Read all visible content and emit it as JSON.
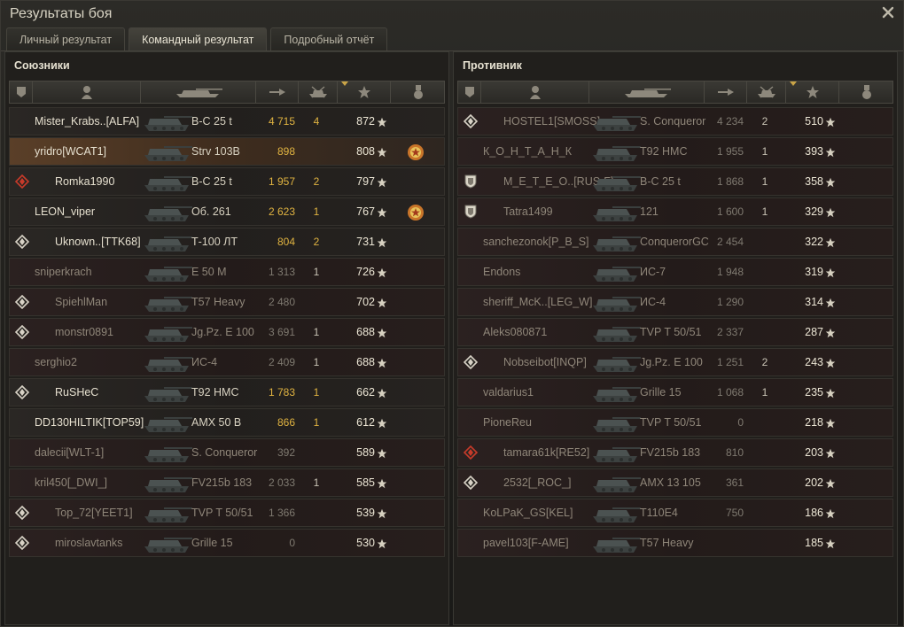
{
  "window": {
    "title": "Результаты боя"
  },
  "tabs": [
    {
      "label": "Личный результат",
      "active": false
    },
    {
      "label": "Командный результат",
      "active": true
    },
    {
      "label": "Подробный отчёт",
      "active": false
    }
  ],
  "columns": [
    {
      "icon": "rank-icon"
    },
    {
      "icon": "player-icon"
    },
    {
      "icon": "tank-icon"
    },
    {
      "icon": "damage-icon"
    },
    {
      "icon": "kills-icon"
    },
    {
      "icon": "experience-star-icon",
      "sorted": true
    },
    {
      "icon": "medal-icon"
    }
  ],
  "colors": {
    "damage": "#e0b341",
    "dim": "#7f7a70",
    "highlight": "#5a3f28"
  },
  "allies": {
    "title": "Союзники",
    "rows": [
      {
        "name": "Mister_Krabs..[ALFA]",
        "tank": "В-С 25 t",
        "damage": "4 715",
        "kills": "4",
        "xp": "872",
        "badge": "none",
        "medal": false,
        "dead": false,
        "highlight": false,
        "dmg_dim": false,
        "kills_dim": false
      },
      {
        "name": "yridro[WCAT1]",
        "tank": "Strv 103B",
        "damage": "898",
        "kills": "",
        "xp": "808",
        "badge": "none",
        "medal": true,
        "dead": false,
        "highlight": true,
        "dmg_dim": false
      },
      {
        "name": "Romka1990",
        "tank": "В-С 25 t",
        "damage": "1 957",
        "kills": "2",
        "xp": "797",
        "badge": "red",
        "medal": false,
        "dead": false,
        "highlight": false,
        "dmg_dim": false
      },
      {
        "name": "LEON_viper",
        "tank": "Об. 261",
        "damage": "2 623",
        "kills": "1",
        "xp": "767",
        "badge": "none",
        "medal": true,
        "dead": false,
        "highlight": false,
        "dmg_dim": false
      },
      {
        "name": "Uknown..[TTK68]",
        "tank": "Т-100 ЛТ",
        "damage": "804",
        "kills": "2",
        "xp": "731",
        "badge": "white",
        "medal": false,
        "dead": false,
        "highlight": false,
        "dmg_dim": false
      },
      {
        "name": "sniperkrach",
        "tank": "E 50 M",
        "damage": "1 313",
        "kills": "1",
        "xp": "726",
        "badge": "none",
        "medal": false,
        "dead": true,
        "highlight": false,
        "dmg_dim": true
      },
      {
        "name": "SpiehlMan",
        "tank": "T57 Heavy",
        "damage": "2 480",
        "kills": "",
        "xp": "702",
        "badge": "white",
        "medal": false,
        "dead": true,
        "highlight": false,
        "dmg_dim": true
      },
      {
        "name": "monstr0891",
        "tank": "Jg.Pz. E 100",
        "damage": "3 691",
        "kills": "1",
        "xp": "688",
        "badge": "white",
        "medal": false,
        "dead": true,
        "highlight": false,
        "dmg_dim": true
      },
      {
        "name": "serghio2",
        "tank": "ИС-4",
        "damage": "2 409",
        "kills": "1",
        "xp": "688",
        "badge": "none",
        "medal": false,
        "dead": true,
        "highlight": false,
        "dmg_dim": true
      },
      {
        "name": "RuSHeC",
        "tank": "T92 HMC",
        "damage": "1 783",
        "kills": "1",
        "xp": "662",
        "badge": "white",
        "medal": false,
        "dead": false,
        "highlight": false,
        "dmg_dim": false
      },
      {
        "name": "DD130HILTIK[TOP59]",
        "tank": "AMX 50 B",
        "damage": "866",
        "kills": "1",
        "xp": "612",
        "badge": "none",
        "medal": false,
        "dead": false,
        "highlight": false,
        "dmg_dim": false
      },
      {
        "name": "dalecii[WLT-1]",
        "tank": "S. Conqueror",
        "damage": "392",
        "kills": "",
        "xp": "589",
        "badge": "none",
        "medal": false,
        "dead": true,
        "highlight": false,
        "dmg_dim": true
      },
      {
        "name": "kril450[_DWI_]",
        "tank": "FV215b 183",
        "damage": "2 033",
        "kills": "1",
        "xp": "585",
        "badge": "none",
        "medal": false,
        "dead": true,
        "highlight": false,
        "dmg_dim": true
      },
      {
        "name": "Top_72[YEET1]",
        "tank": "TVP T 50/51",
        "damage": "1 366",
        "kills": "",
        "xp": "539",
        "badge": "white",
        "medal": false,
        "dead": true,
        "highlight": false,
        "dmg_dim": true
      },
      {
        "name": "miroslavtanks",
        "tank": "Grille 15",
        "damage": "0",
        "kills": "",
        "xp": "530",
        "badge": "white",
        "medal": false,
        "dead": true,
        "highlight": false,
        "dmg_dim": true
      }
    ]
  },
  "enemies": {
    "title": "Противник",
    "rows": [
      {
        "name": "HOSTEL1[SMOSS]",
        "tank": "S. Conqueror",
        "damage": "4 234",
        "kills": "2",
        "xp": "510",
        "badge": "white",
        "medal": false,
        "dead": true,
        "highlight": false,
        "dmg_dim": true
      },
      {
        "name": "К_О_Н_Т_А_Н_К",
        "tank": "T92 HMC",
        "damage": "1 955",
        "kills": "1",
        "xp": "393",
        "badge": "none",
        "medal": false,
        "dead": true,
        "highlight": false,
        "dmg_dim": true
      },
      {
        "name": "M_E_T_E_O..[RUS-F]",
        "tank": "В-С 25 t",
        "damage": "1 868",
        "kills": "1",
        "xp": "358",
        "badge": "shield",
        "medal": false,
        "dead": true,
        "highlight": false,
        "dmg_dim": true
      },
      {
        "name": "Tatra1499",
        "tank": "121",
        "damage": "1 600",
        "kills": "1",
        "xp": "329",
        "badge": "shield",
        "medal": false,
        "dead": true,
        "highlight": false,
        "dmg_dim": true
      },
      {
        "name": "sanchezonok[P_B_S]",
        "tank": "ConquerorGC",
        "damage": "2 454",
        "kills": "",
        "xp": "322",
        "badge": "none",
        "medal": false,
        "dead": true,
        "highlight": false,
        "dmg_dim": true
      },
      {
        "name": "Endons",
        "tank": "ИС-7",
        "damage": "1 948",
        "kills": "",
        "xp": "319",
        "badge": "none",
        "medal": false,
        "dead": true,
        "highlight": false,
        "dmg_dim": true
      },
      {
        "name": "sheriff_McK..[LEG_W]",
        "tank": "ИС-4",
        "damage": "1 290",
        "kills": "",
        "xp": "314",
        "badge": "none",
        "medal": false,
        "dead": true,
        "highlight": false,
        "dmg_dim": true
      },
      {
        "name": "Aleks080871",
        "tank": "TVP T 50/51",
        "damage": "2 337",
        "kills": "",
        "xp": "287",
        "badge": "none",
        "medal": false,
        "dead": true,
        "highlight": false,
        "dmg_dim": true
      },
      {
        "name": "Nobseibot[INQP]",
        "tank": "Jg.Pz. E 100",
        "damage": "1 251",
        "kills": "2",
        "xp": "243",
        "badge": "white",
        "medal": false,
        "dead": true,
        "highlight": false,
        "dmg_dim": true
      },
      {
        "name": "valdarius1",
        "tank": "Grille 15",
        "damage": "1 068",
        "kills": "1",
        "xp": "235",
        "badge": "none",
        "medal": false,
        "dead": true,
        "highlight": false,
        "dmg_dim": true
      },
      {
        "name": "PioneReu",
        "tank": "TVP T 50/51",
        "damage": "0",
        "kills": "",
        "xp": "218",
        "badge": "none",
        "medal": false,
        "dead": true,
        "highlight": false,
        "dmg_dim": true
      },
      {
        "name": "tamara61k[RE52]",
        "tank": "FV215b 183",
        "damage": "810",
        "kills": "",
        "xp": "203",
        "badge": "red",
        "medal": false,
        "dead": true,
        "highlight": false,
        "dmg_dim": true
      },
      {
        "name": "2532[_ROC_]",
        "tank": "AMX 13 105",
        "damage": "361",
        "kills": "",
        "xp": "202",
        "badge": "white",
        "medal": false,
        "dead": true,
        "highlight": false,
        "dmg_dim": true
      },
      {
        "name": "KoLPaK_GS[KEL]",
        "tank": "T110E4",
        "damage": "750",
        "kills": "",
        "xp": "186",
        "badge": "none",
        "medal": false,
        "dead": true,
        "highlight": false,
        "dmg_dim": true
      },
      {
        "name": "pavel103[F-AME]",
        "tank": "T57 Heavy",
        "damage": "",
        "kills": "",
        "xp": "185",
        "badge": "none",
        "medal": false,
        "dead": true,
        "highlight": false,
        "dmg_dim": true
      }
    ]
  }
}
